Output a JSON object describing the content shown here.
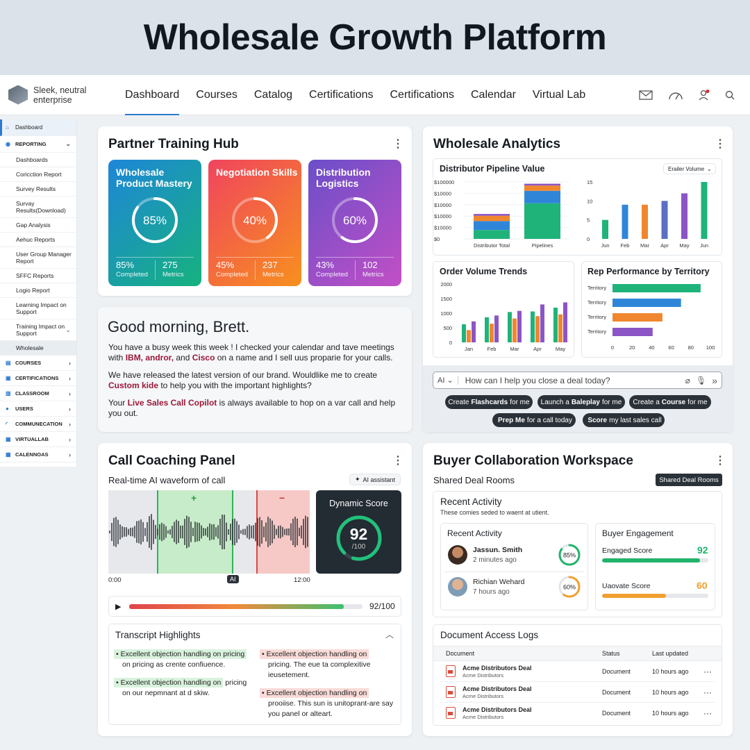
{
  "page_title": "Wholesale Growth Platform",
  "brand": {
    "line1": "Sleek, neutral",
    "line2": "enterprise"
  },
  "nav": [
    "Dashboard",
    "Courses",
    "Catalog",
    "Certifications",
    "Certifications",
    "Calendar",
    "Virtual Lab"
  ],
  "sidebar": {
    "dashboard": "Dashboard",
    "reporting": "REPORTING",
    "reports": [
      "Dashboards",
      "Coricction Report",
      "Survey Results",
      "Survay Results(Download)",
      "Gap Analysis",
      "Aehuc Reports",
      "User Group Manager Report",
      "SFFC Reports",
      "Logio Report",
      "Learning Impact on Support",
      "Training Impact on Support",
      "Wholesale"
    ],
    "sections": [
      "COURSES",
      "CERTIFICATIONS",
      "CLASSROOM",
      "USERS",
      "COMMUNECATION",
      "VIRTUALLAB",
      "CALENNOAS"
    ]
  },
  "training_hub": {
    "title": "Partner Training Hub",
    "tiles": [
      {
        "title": "Wholesale Product Mastery",
        "percent": "85%",
        "completed": "85%",
        "completed_label": "Completed",
        "metrics": "275",
        "metrics_label": "Metrics",
        "progress": 0.85
      },
      {
        "title": "Negotiation Skills",
        "percent": "40%",
        "completed": "45%",
        "completed_label": "Completed",
        "metrics": "237",
        "metrics_label": "Metrics",
        "progress": 0.4
      },
      {
        "title": "Distribution Logistics",
        "percent": "60%",
        "completed": "43%",
        "completed_label": "Completed",
        "metrics": "102",
        "metrics_label": "Metrics",
        "progress": 0.6
      }
    ]
  },
  "greeting": {
    "headline": "Good morning, Brett.",
    "p1_a": "You have a busy week this week ! I checked your calendar and tave meetings with",
    "p1_b": "IBM, andror,",
    "p1_c": " and ",
    "p1_d": "Cisco",
    "p1_e": " on a name and I sell uus proparie for your calls.",
    "p2_a": "We have released the latest version of our brand. Wouldlike me to create ",
    "p2_b": "Custom kide",
    "p2_c": " to help you with the important highlights?",
    "p3_a": "Your ",
    "p3_b": "Live Sales Call Copilot",
    "p3_c": " is always available to hop on a var call and help you out."
  },
  "analytics": {
    "title": "Wholesale Analytics",
    "dropdown": "Erailer Volume",
    "pipeline_title": "Distributor Pipeline Value",
    "order_title": "Order Volume Trends",
    "rep_title": "Rep Performance by Territory",
    "ai_prefix": "AI",
    "ai_placeholder": "How can I help you close a deal today?",
    "chips": [
      {
        "pre": "Create",
        "bold": "Flashcards",
        "post": "for me"
      },
      {
        "pre": "Launch a",
        "bold": "Baleplay",
        "post": "for me"
      },
      {
        "pre": "Create a",
        "bold": "Course",
        "post": "for me"
      },
      {
        "pre": "",
        "bold": "Prep Me",
        "post": "for a call today"
      },
      {
        "pre": "",
        "bold": "Score",
        "post": "my last sales call"
      }
    ]
  },
  "chart_data": [
    {
      "type": "bar",
      "title": "Distributor Pipeline Value",
      "categories": [
        "Distributor Total",
        "Pipelines"
      ],
      "y_ticks": [
        "$100000",
        "$10000",
        "$10000",
        "$10000",
        "$10000",
        "$0"
      ],
      "series": [
        {
          "color": "#1fb37a",
          "values": [
            1,
            4
          ]
        },
        {
          "color": "#2f86d8",
          "values": [
            1,
            1.4
          ]
        },
        {
          "color": "#f0872e",
          "values": [
            0.6,
            0.6
          ]
        },
        {
          "color": "#8b55c6",
          "values": [
            0.2,
            0.2
          ]
        }
      ]
    },
    {
      "type": "bar",
      "title": "",
      "categories": [
        "Jun",
        "Feb",
        "Mar",
        "Apr",
        "May",
        "Jun"
      ],
      "values": [
        5,
        9,
        9,
        10,
        12,
        15
      ],
      "ylim": [
        0,
        15
      ],
      "y_ticks": [
        15,
        10,
        5,
        0
      ]
    },
    {
      "type": "bar",
      "title": "Order Volume Trends",
      "categories": [
        "Jan",
        "Feb",
        "Mar",
        "Apr",
        "May"
      ],
      "y_ticks": [
        2000,
        1500,
        1000,
        500,
        0
      ],
      "series": [
        {
          "color": "#1fb37a",
          "values": [
            620,
            860,
            1040,
            1060,
            1190
          ]
        },
        {
          "color": "#f0872e",
          "values": [
            420,
            640,
            820,
            900,
            960
          ]
        },
        {
          "color": "#8b55c6",
          "values": [
            720,
            920,
            1080,
            1300,
            1370
          ]
        }
      ]
    },
    {
      "type": "bar",
      "title": "Rep Performance by Territory",
      "categories": [
        "Territory",
        "Territory",
        "Territory",
        "Territory"
      ],
      "values": [
        90,
        70,
        51,
        41
      ],
      "xlim": [
        0,
        100
      ],
      "x_ticks": [
        0,
        20,
        40,
        60,
        80,
        100
      ],
      "colors": [
        "#1fb37a",
        "#2f86d8",
        "#f0872e",
        "#8b55c6"
      ]
    }
  ],
  "coaching": {
    "title": "Call Coaching Panel",
    "subtitle": "Real-time AI waveform of call",
    "ai_badge": "AI assistant",
    "plus": "+",
    "minus": "−",
    "t_start": "0:00",
    "t_ai": "AI",
    "t_end": "12:00",
    "score_label": "Dynamic Score",
    "score": "92",
    "score_of": "/100",
    "score_value": 0.92,
    "bar_score": "92/100",
    "bar_value": 0.92,
    "transcript_title": "Transcript Highlights",
    "left": [
      {
        "hl": "Excellent objection handling on pricing",
        "rest": "on pricing as crente confiuence."
      },
      {
        "hl": "Excellent objection handling on",
        "rest": "pricing on our nepmnant at d skiw.",
        "inline": "pricing"
      }
    ],
    "right": [
      {
        "hl": "Excellent objection handling on",
        "rest": "pricing. The eue ta complexitive ieusetement."
      },
      {
        "hl": "Excellent objection handling on",
        "rest": "prooiise. This sun is unitoprant-are say you panel or alteart."
      }
    ]
  },
  "collab": {
    "title": "Buyer Collaboration Workspace",
    "subtitle": "Shared Deal Rooms",
    "badge": "Shared Deal Rooms",
    "recent_title": "Recent Activity",
    "recent_desc": "These comies seded to waent at utient.",
    "inner_recent": "Recent Activity",
    "people": [
      {
        "name": "Jassun. Smith",
        "time": "2 minutes ago",
        "pct": "85%",
        "value": 0.85,
        "color": "#22b36b"
      },
      {
        "name": "Richian Wehard",
        "time": "7 hours ago",
        "pct": "60%",
        "value": 0.6,
        "color": "#f0a030"
      }
    ],
    "engagement_title": "Buyer Engagement",
    "scores": [
      {
        "label": "Engaged Score",
        "value": "92",
        "fill": 0.92,
        "color": "#22b36b"
      },
      {
        "label": "Uaovate Score",
        "value": "60",
        "fill": 0.6,
        "color": "#f0a030"
      }
    ],
    "logs_title": "Document Access Logs",
    "cols": [
      "Document",
      "Status",
      "Last updated"
    ],
    "rows": [
      {
        "doc": "Acme Distributors Deal",
        "sub": "Acme Distributors",
        "status": "Document",
        "updated": "10 hours ago"
      },
      {
        "doc": "Acme Distributors Deal",
        "sub": "Acme Distributors",
        "status": "Document",
        "updated": "10 hours ago"
      },
      {
        "doc": "Acme Distributors Deal",
        "sub": "Acme Distributors",
        "status": "Document",
        "updated": "10 hours ago"
      }
    ]
  }
}
